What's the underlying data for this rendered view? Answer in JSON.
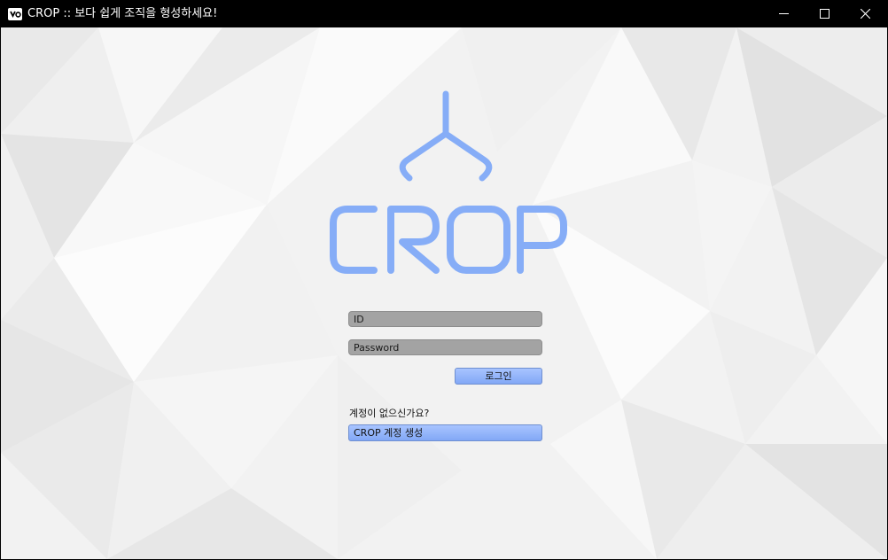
{
  "window": {
    "title": "CROP :: 보다 쉽게 조직을 형성하세요!",
    "app_icon": "crop-app-icon",
    "controls": [
      "minimize-icon",
      "maximize-icon",
      "close-icon"
    ]
  },
  "logo": {
    "text": "CROP",
    "icon": "claw-hook-icon",
    "color": "#86adf7"
  },
  "login": {
    "id_placeholder": "ID",
    "password_placeholder": "Password",
    "login_label": "로그인"
  },
  "signup": {
    "prompt": "계정이 없으신가요?",
    "create_label": "CROP 계정 생성"
  },
  "theme": {
    "titlebar_bg": "#000000",
    "field_bg": "#a3a3a3",
    "button_bg": "#96b6fb",
    "background": "low-poly light gray"
  }
}
